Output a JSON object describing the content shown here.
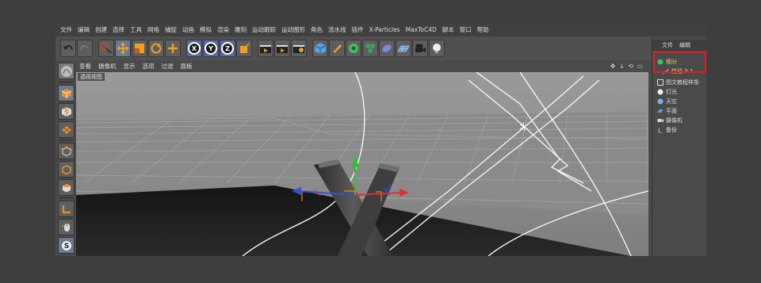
{
  "menubar": {
    "items": [
      "文件",
      "编辑",
      "创建",
      "选择",
      "工具",
      "网格",
      "捕捉",
      "动画",
      "模拟",
      "渲染",
      "雕刻",
      "运动跟踪",
      "运动图形",
      "角色",
      "流水线",
      "插件",
      "X-Particles",
      "MaxToC4D",
      "脚本",
      "窗口",
      "帮助"
    ]
  },
  "toolbar": {
    "axis_x": "X",
    "axis_y": "Y",
    "axis_z": "Z",
    "icons": [
      "undo-icon",
      "redo-icon",
      "select-icon",
      "move-icon",
      "scale-icon",
      "rotate-icon",
      "add-icon",
      "coord-icon",
      "render-view-icon",
      "render-icon",
      "render-settings-icon",
      "cube-icon",
      "pen-icon",
      "gear-object-icon",
      "deformer-icon",
      "floor-icon",
      "camera-icon",
      "light-icon"
    ]
  },
  "viewport": {
    "menus": [
      "查看",
      "摄像机",
      "显示",
      "选项",
      "过滤",
      "面板"
    ],
    "label": "透视视图",
    "nav_controls": "✥ ↓ ⟲ ▭"
  },
  "object_manager": {
    "tabs": [
      "文件",
      "编辑"
    ],
    "objects": [
      {
        "name": "细分",
        "level": 0,
        "icon": "subdivision-icon",
        "color": "#e8d070"
      },
      {
        "name": "路径 3.1",
        "level": 1,
        "icon": "spline-icon",
        "color": "#e8d070"
      },
      {
        "name": "图文教程样条",
        "level": 0,
        "icon": "spline-text-icon",
        "color": "#dcdcdc"
      },
      {
        "name": "灯光",
        "level": 0,
        "icon": "light-icon",
        "color": "#dcdcdc"
      },
      {
        "name": "天空",
        "level": 0,
        "icon": "sky-icon",
        "color": "#dcdcdc"
      },
      {
        "name": "平面",
        "level": 0,
        "icon": "plane-icon",
        "color": "#dcdcdc"
      },
      {
        "name": "摄像机",
        "level": 0,
        "icon": "camera-icon",
        "color": "#dcdcdc"
      },
      {
        "name": "备份",
        "level": 0,
        "icon": "null-icon",
        "color": "#dcdcdc"
      }
    ]
  },
  "colors": {
    "accent_blue": "#6a7a92",
    "highlight_red": "#e02020",
    "selected_text": "#e8d070",
    "axis_x": "#e03030",
    "axis_y": "#30c030",
    "axis_z": "#3050e0"
  }
}
